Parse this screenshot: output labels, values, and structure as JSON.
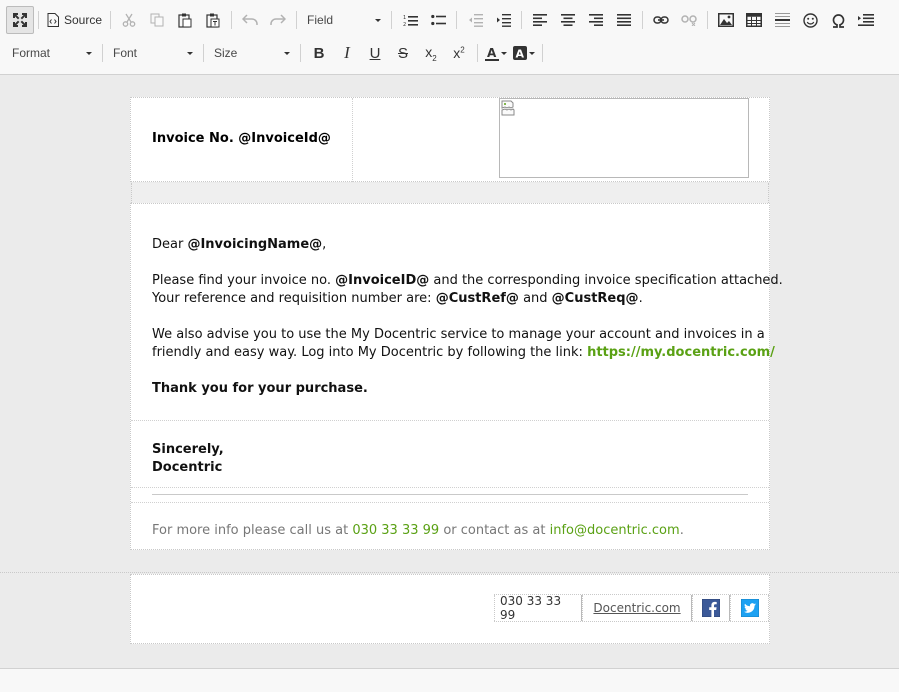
{
  "toolbar": {
    "source_label": "Source",
    "field_combo": "Field",
    "format_combo": "Format",
    "font_combo": "Font",
    "size_combo": "Size",
    "text_color_letter": "A",
    "bg_color_letter": "A"
  },
  "invoice_header": {
    "invoice_label": "Invoice No.",
    "invoice_id": "@InvoiceId@"
  },
  "letter": {
    "greeting_prefix": "Dear",
    "invoicing_name": "@InvoicingName@",
    "greeting_suffix": ",",
    "p1_a": "Please find your invoice no.",
    "p1_invoice_id": "@InvoiceID@",
    "p1_b": "and the corresponding invoice specification attached.",
    "p1_c": "Your reference and requisition number are:",
    "p1_custref": "@CustRef@",
    "p1_and": "and",
    "p1_custreq": "@CustReq@",
    "p1_dot": ".",
    "p2_a": "We also advise you to use the My Docentric service to manage your account and invoices in a",
    "p2_b": "friendly and easy way. Log into My Docentric by following the link:",
    "p2_link": "https://my.docentric.com/",
    "thanks": "Thank you for your purchase.",
    "sign_1": "Sincerely,",
    "sign_2": "Docentric",
    "info_a": "For more info please call us at",
    "info_phone": "030 33 33 99",
    "info_b": "or contact as at",
    "info_email": "info@docentric.com",
    "info_dot": "."
  },
  "footer": {
    "phone": "030 33 33 99",
    "website": "Docentric.com"
  },
  "colors": {
    "link_green": "#5aa114",
    "facebook": "#3b5998",
    "twitter": "#1da1f2"
  }
}
